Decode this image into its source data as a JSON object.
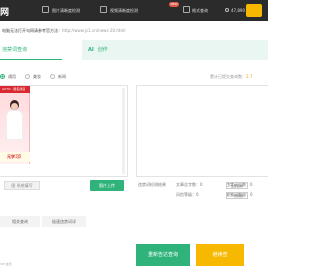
{
  "header": {
    "logo": "网",
    "nav": [
      "图片清晰度检测",
      "视频清晰度检测",
      "格式查询"
    ],
    "badge": "NEW",
    "counter": "47,890"
  },
  "notice": {
    "text": "电脑无法打开句网请参考官方法：",
    "url": "http://www.jc1.cn/news-20.html"
  },
  "tabs": {
    "main": "违禁词查询",
    "ai_prefix": "AI",
    "ai_label": "创作"
  },
  "modes": {
    "options": [
      "通用",
      "美妆",
      "新闻"
    ],
    "count_label": "累计已提交查询数：",
    "count_value": "2.7"
  },
  "ad": {
    "head": "AUTO · 报名通道",
    "foot": "元学习】"
  },
  "left_footer": {
    "upload": "图 系统填写",
    "green_button": "图片上传"
  },
  "right_footer": {
    "label": "违禁词检测结果",
    "stats": [
      "文章总字数：0",
      "违禁词总数：0",
      "风险等级：0",
      "敏感词数量：0"
    ],
    "mini_buttons": [
      "全部复制",
      "一键替换"
    ]
  },
  "bottom": {
    "tabs": [
      "相关查询",
      "极速违禁词详"
    ],
    "start_button": "重新告达查询",
    "ai_button": "继续查",
    "footer": "VIP 会员"
  },
  "colors": {
    "accent": "#2fb37a",
    "gold": "#f6b800",
    "topbar": "#2b2b2b"
  }
}
